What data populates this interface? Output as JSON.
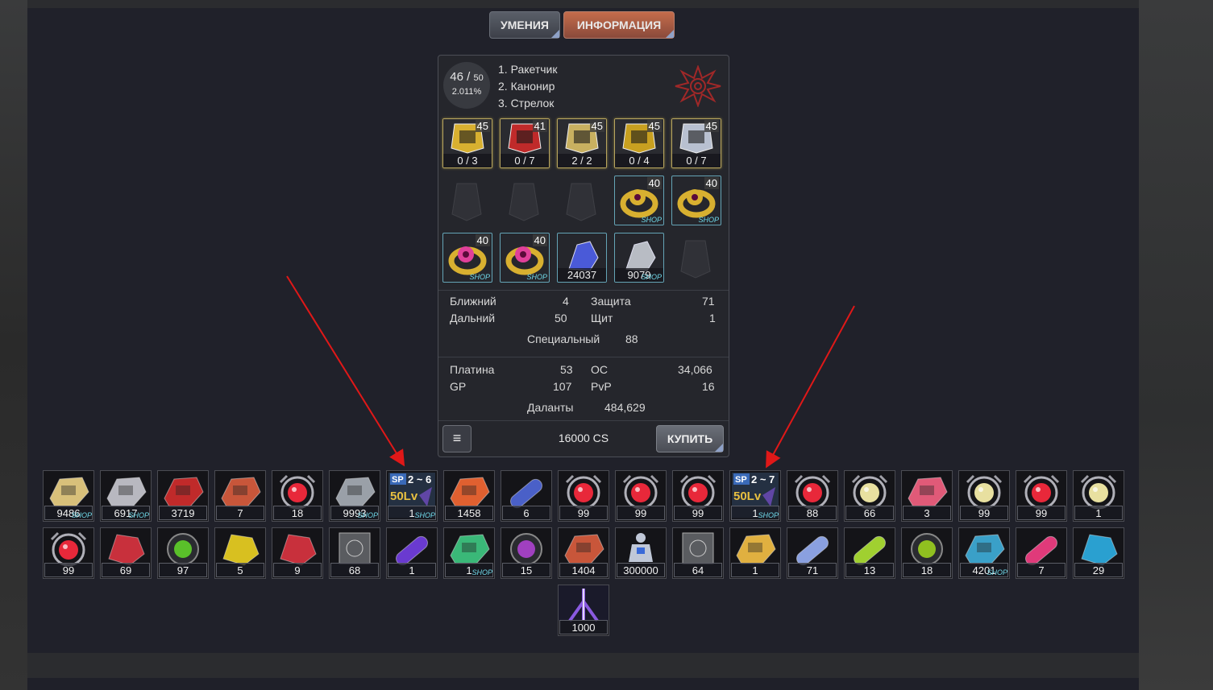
{
  "tabs": {
    "skills": "УМЕНИЯ",
    "info": "ИНФОРМАЦИЯ"
  },
  "character": {
    "level": "46 / ",
    "level_max": "50",
    "exp_percent": "2.011%",
    "classes": [
      "1. Ракетчик",
      "2. Канонир",
      "3. Стрелок"
    ]
  },
  "equipment_row1": [
    {
      "level": "45",
      "count": "0 / 3",
      "icon": "helmet-icon"
    },
    {
      "level": "41",
      "count": "0 / 7",
      "icon": "armor-icon"
    },
    {
      "level": "45",
      "count": "2 / 2",
      "icon": "gloves-icon"
    },
    {
      "level": "45",
      "count": "0 / 4",
      "icon": "boots-icon"
    },
    {
      "level": "45",
      "count": "0 / 7",
      "icon": "weapon-icon"
    }
  ],
  "equipment_row2": [
    {
      "level": "",
      "icon": "vest-slot-icon",
      "empty": true
    },
    {
      "level": "",
      "icon": "crossed-weapons-slot-icon",
      "empty": true
    },
    {
      "level": "",
      "icon": "cloak-slot-icon",
      "empty": true
    },
    {
      "level": "40",
      "icon": "gold-ring-icon",
      "shop": "SHOP"
    },
    {
      "level": "40",
      "icon": "gold-ring-icon",
      "shop": "SHOP"
    }
  ],
  "equipment_row3": [
    {
      "level": "40",
      "icon": "pink-orb-ring-icon",
      "shop": "SHOP"
    },
    {
      "level": "40",
      "icon": "pink-orb-ring-icon",
      "shop": "SHOP"
    },
    {
      "level": "",
      "count": "24037",
      "icon": "blue-gauntlet-icon"
    },
    {
      "level": "",
      "count": "9079",
      "icon": "grey-gauntlet-icon",
      "shop": "SHOP"
    },
    {
      "level": "",
      "icon": "glove-slot-icon",
      "empty": true
    }
  ],
  "stats": {
    "melee_label": "Ближний",
    "melee": "4",
    "ranged_label": "Дальний",
    "ranged": "50",
    "defense_label": "Защита",
    "defense": "71",
    "shield_label": "Щит",
    "shield": "1",
    "special_label": "Специальный",
    "special": "88",
    "platinum_label": "Платина",
    "platinum": "53",
    "oc_label": "ОС",
    "oc": "34,066",
    "gp_label": "GP",
    "gp": "107",
    "pvp_label": "PvP",
    "pvp": "16",
    "dalants_label": "Даланты",
    "dalants": "484,629"
  },
  "footer": {
    "price": "16000 CS",
    "buy": "КУПИТЬ",
    "menu_icon": "≡"
  },
  "inventory_row1": [
    {
      "qty": "9486",
      "icon": "gatling-gun-icon",
      "shop": "SHOP",
      "color": "#d8c07a"
    },
    {
      "qty": "6917",
      "icon": "launcher-icon",
      "shop": "SHOP",
      "color": "#b8b8c0"
    },
    {
      "qty": "3719",
      "icon": "red-cannon-icon",
      "color": "#c02a2a"
    },
    {
      "qty": "7",
      "icon": "turret-icon",
      "color": "#c8563a"
    },
    {
      "qty": "18",
      "icon": "red-potion-icon",
      "color": "#e8283a"
    },
    {
      "qty": "9993",
      "icon": "ammo-box-icon",
      "shop": "SHOP",
      "color": "#9aa0a8"
    },
    {
      "qty": "1",
      "icon": "sp-scroll-icon",
      "shop": "SHOP",
      "color": "#3a6ab8",
      "label_top": "SP 2 ~ 6",
      "label_mid": "50Lv"
    },
    {
      "qty": "1458",
      "icon": "fire-turret-icon",
      "color": "#e06030"
    },
    {
      "qty": "6",
      "icon": "capsule-machine-icon",
      "color": "#4a60c8"
    },
    {
      "qty": "99",
      "icon": "red-potion-icon",
      "color": "#e8283a"
    },
    {
      "qty": "99",
      "icon": "red-potion-icon",
      "color": "#e8283a"
    },
    {
      "qty": "99",
      "icon": "red-potion-icon",
      "color": "#e8283a"
    },
    {
      "qty": "1",
      "icon": "sp-scroll-icon",
      "shop": "SHOP",
      "color": "#3a6ab8",
      "label_top": "SP 2 ~ 7",
      "label_mid": "50Lv"
    },
    {
      "qty": "88",
      "icon": "red-potion-icon",
      "color": "#e8283a"
    },
    {
      "qty": "66",
      "icon": "cream-potion-icon",
      "color": "#e8e0a0"
    },
    {
      "qty": "3",
      "icon": "pink-vial-icon",
      "color": "#e05a78"
    },
    {
      "qty": "99",
      "icon": "cream-potion-icon",
      "color": "#e8e0a0"
    },
    {
      "qty": "99",
      "icon": "red-potion-icon",
      "color": "#e8283a"
    },
    {
      "qty": "1",
      "icon": "cream-potion-icon",
      "color": "#e8e0a0"
    }
  ],
  "inventory_row2": [
    {
      "qty": "99",
      "icon": "red-potion-icon",
      "color": "#e8283a"
    },
    {
      "qty": "69",
      "icon": "red-crystal-icon",
      "color": "#c8303c"
    },
    {
      "qty": "97",
      "icon": "green-orb-icon",
      "color": "#5ac02a"
    },
    {
      "qty": "5",
      "icon": "yellow-crystal-icon",
      "color": "#d8c020"
    },
    {
      "qty": "9",
      "icon": "red-crystal-icon",
      "color": "#c8303c"
    },
    {
      "qty": "68",
      "icon": "metal-plate-icon",
      "color": "#8a8c90"
    },
    {
      "qty": "1",
      "icon": "purple-capsule-icon",
      "color": "#6a3ad0"
    },
    {
      "qty": "1",
      "icon": "green-pod-icon",
      "shop": "SHOP",
      "color": "#3ab878"
    },
    {
      "qty": "15",
      "icon": "purple-orb-icon",
      "color": "#a040c0"
    },
    {
      "qty": "1404",
      "icon": "turret-icon",
      "color": "#c8563a"
    },
    {
      "qty": "300000",
      "icon": "robot-icon",
      "color": "#c0c8d8"
    },
    {
      "qty": "64",
      "icon": "metal-plate-icon",
      "color": "#8a8c90"
    },
    {
      "qty": "1",
      "icon": "gold-cannon-icon",
      "color": "#e0b040"
    },
    {
      "qty": "71",
      "icon": "blue-capsule-icon",
      "color": "#8aa0e0"
    },
    {
      "qty": "13",
      "icon": "green-capsule-icon",
      "color": "#a0d030"
    },
    {
      "qty": "18",
      "icon": "green-orb-icon",
      "color": "#90c020"
    },
    {
      "qty": "4201",
      "icon": "blue-blaster-icon",
      "shop": "SHOP",
      "color": "#3aa0c8"
    },
    {
      "qty": "7",
      "icon": "pink-capsule-icon",
      "color": "#e03a7a"
    },
    {
      "qty": "29",
      "icon": "blue-crystal-icon",
      "color": "#2aa0d0"
    }
  ],
  "inventory_row3": [
    {
      "qty": "1000",
      "icon": "purple-beam-icon",
      "color": "#8a5ae0"
    }
  ]
}
